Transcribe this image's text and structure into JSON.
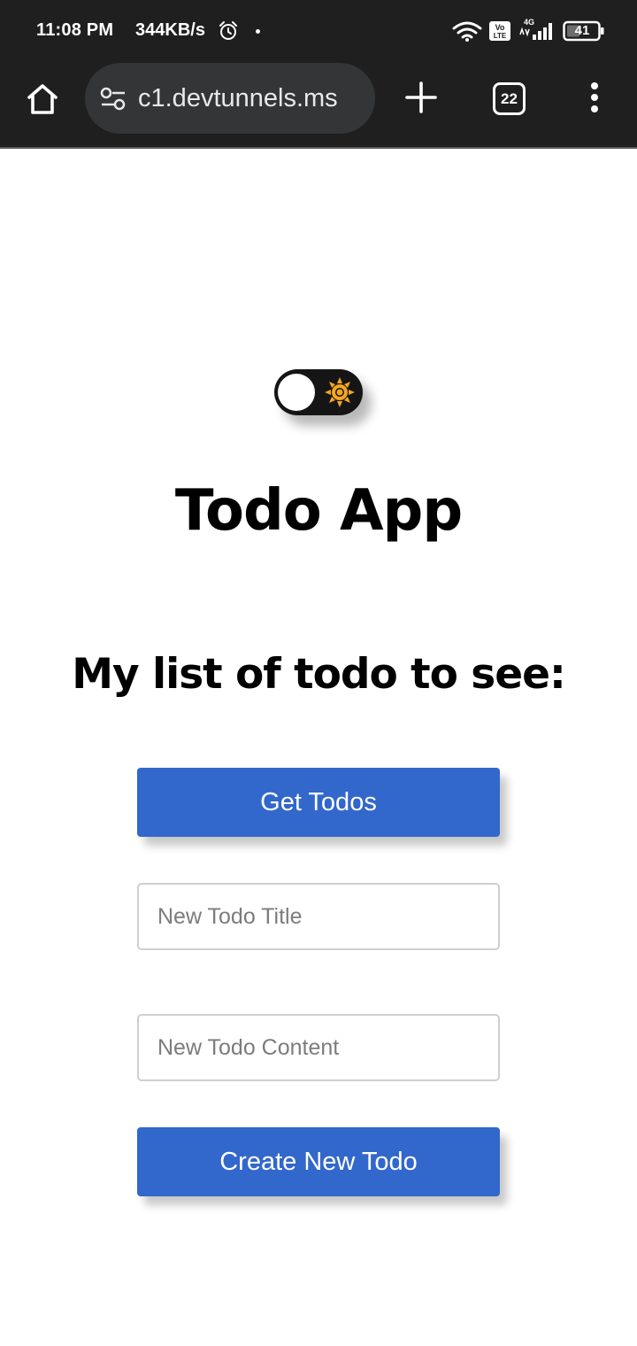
{
  "status_bar": {
    "time": "11:08 PM",
    "speed": "344KB/s",
    "battery": "41",
    "network": "4G",
    "icons": [
      "alarm-icon",
      "wifi-icon",
      "volte-icon",
      "signal-icon",
      "battery-icon"
    ]
  },
  "browser": {
    "url": "c1.devtunnels.ms",
    "tab_count": "22",
    "icons": [
      "home-icon",
      "site-settings-icon",
      "new-tab-icon",
      "tab-switcher-icon",
      "menu-icon"
    ]
  },
  "page": {
    "theme_toggle": {
      "state": "light",
      "icon": "sun-icon"
    },
    "title": "Todo App",
    "subtitle": "My list of todo to see:",
    "get_button": "Get Todos",
    "title_placeholder": "New Todo Title",
    "content_placeholder": "New Todo Content",
    "create_button": "Create New Todo"
  },
  "colors": {
    "chrome_bg": "#1f1f1f",
    "url_bar_bg": "#333537",
    "button_blue": "#3267cc",
    "toggle_bg": "#151515",
    "sun_orange": "#f5a623"
  }
}
